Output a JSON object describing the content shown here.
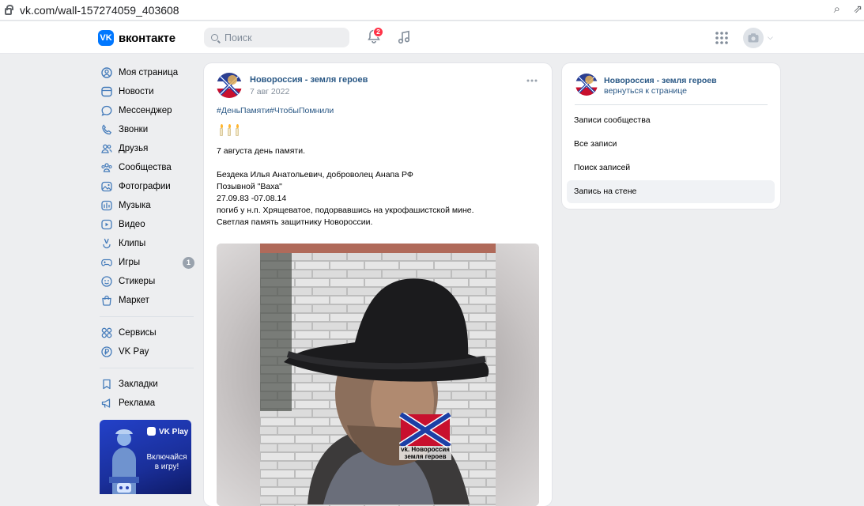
{
  "browser": {
    "url": "vk.com/wall-157274059_403608"
  },
  "header": {
    "logo_text": "вконтакте",
    "logo_mark": "VK",
    "search_placeholder": "Поиск",
    "notifications_count": "2"
  },
  "sidebar": {
    "items": [
      {
        "label": "Моя страница",
        "icon": "user-icon"
      },
      {
        "label": "Новости",
        "icon": "news-icon"
      },
      {
        "label": "Мессенджер",
        "icon": "chat-icon"
      },
      {
        "label": "Звонки",
        "icon": "phone-icon"
      },
      {
        "label": "Друзья",
        "icon": "friends-icon"
      },
      {
        "label": "Сообщества",
        "icon": "communities-icon"
      },
      {
        "label": "Фотографии",
        "icon": "photo-icon"
      },
      {
        "label": "Музыка",
        "icon": "music-icon"
      },
      {
        "label": "Видео",
        "icon": "video-icon"
      },
      {
        "label": "Клипы",
        "icon": "clips-icon"
      },
      {
        "label": "Игры",
        "icon": "games-icon",
        "count": "1"
      },
      {
        "label": "Стикеры",
        "icon": "sticker-icon"
      },
      {
        "label": "Маркет",
        "icon": "market-icon"
      }
    ],
    "items2": [
      {
        "label": "Сервисы",
        "icon": "services-icon"
      },
      {
        "label": "VK Pay",
        "icon": "vkpay-icon"
      }
    ],
    "items3": [
      {
        "label": "Закладки",
        "icon": "bookmark-icon"
      },
      {
        "label": "Реклама",
        "icon": "ads-icon"
      }
    ],
    "promo": {
      "brand": "VK Play",
      "text": "Включайся в игру!"
    }
  },
  "post": {
    "group_name": "Новороссия - земля героев",
    "date": "7 авг 2022",
    "tags": "#ДеньПамяти#ЧтобыПомнили",
    "line1": "7 августа день памяти.",
    "line2": "Бездека Илья Анатольевич, доброволец Анапа РФ",
    "line3": "Позывной \"Ваха\"",
    "line4": "27.09.83 -07.08.14",
    "line5": "погиб у н.п. Хрящеватое, подорвавшись на укрофашистской мине.",
    "line6": "Светлая память защитнику Новороссии.",
    "watermark": "vk. Новороссия земля героев"
  },
  "right_panel": {
    "group_name": "Новороссия - земля героев",
    "back_link": "вернуться к странице",
    "links": [
      "Записи сообщества",
      "Все записи",
      "Поиск записей",
      "Запись на стене"
    ]
  },
  "colors": {
    "accent": "#2a5885",
    "vk_blue": "#0077ff",
    "badge_red": "#ff3347",
    "page_bg": "#edeef0"
  }
}
